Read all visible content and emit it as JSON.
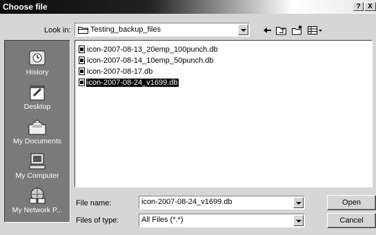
{
  "window": {
    "title": "Choose file",
    "help_label": "?",
    "close_label": "X"
  },
  "lookin": {
    "label": "Look in:",
    "value": "Testing_backup_files"
  },
  "toolbar": {
    "back_icon": "back-arrow-icon",
    "up_icon": "up-folder-icon",
    "new_folder_icon": "new-folder-icon",
    "view_icon": "view-menu-icon"
  },
  "places": [
    {
      "label": "History",
      "icon": "history-icon"
    },
    {
      "label": "Desktop",
      "icon": "desktop-icon"
    },
    {
      "label": "My Documents",
      "icon": "my-documents-icon"
    },
    {
      "label": "My Computer",
      "icon": "my-computer-icon"
    },
    {
      "label": "My Network P...",
      "icon": "my-network-places-icon"
    }
  ],
  "files": [
    {
      "name": "icon-2007-08-13_20emp_100punch.db",
      "selected": false
    },
    {
      "name": "icon-2007-08-14_10emp_50punch.db",
      "selected": false
    },
    {
      "name": "icon-2007-08-17.db",
      "selected": false
    },
    {
      "name": "icon-2007-08-24_v1699.db",
      "selected": true
    }
  ],
  "filename": {
    "label": "File name:",
    "value": "icon-2007-08-24_v1699.db"
  },
  "filetype": {
    "label": "Files of type:",
    "value": "All Files (*.*)"
  },
  "buttons": {
    "open": "Open",
    "cancel": "Cancel"
  },
  "colors": {
    "places_bg": "#7a7a7a",
    "dialog_bg": "#d6d6d6",
    "selection": "#000000"
  }
}
